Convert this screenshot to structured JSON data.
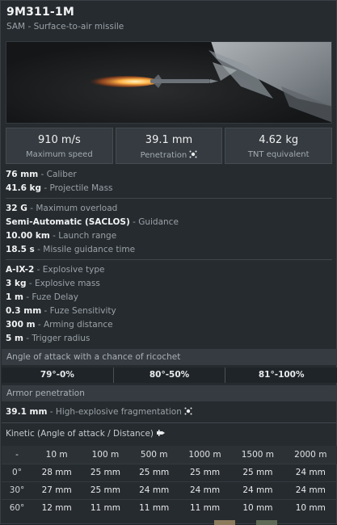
{
  "header": {
    "title": "9M311-1M",
    "subtitle": "SAM - Surface-to-air missile"
  },
  "stats": [
    {
      "value": "910 m/s",
      "label": "Maximum speed"
    },
    {
      "value": "39.1 mm",
      "label": "Penetration"
    },
    {
      "value": "4.62 kg",
      "label": "TNT equivalent"
    }
  ],
  "group1": [
    {
      "value": "76 mm",
      "label": "- Caliber"
    },
    {
      "value": "41.6 kg",
      "label": "- Projectile Mass"
    }
  ],
  "group2": [
    {
      "value": "32 G",
      "label": "- Maximum overload"
    },
    {
      "value": "Semi-Automatic (SACLOS)",
      "label": "- Guidance"
    },
    {
      "value": "10.00 km",
      "label": "- Launch range"
    },
    {
      "value": "18.5 s",
      "label": "- Missile guidance time"
    }
  ],
  "group3": [
    {
      "value": "A-IX-2",
      "label": "- Explosive type"
    },
    {
      "value": "3 kg",
      "label": "- Explosive mass"
    },
    {
      "value": "1 m",
      "label": "- Fuze Delay"
    },
    {
      "value": "0.3 mm",
      "label": "- Fuze Sensitivity"
    },
    {
      "value": "300 m",
      "label": "- Arming distance"
    },
    {
      "value": "5 m",
      "label": "- Trigger radius"
    }
  ],
  "ricochet": {
    "header": "Angle of attack with a chance of ricochet",
    "values": [
      "79°-0%",
      "80°-50%",
      "81°-100%"
    ]
  },
  "armor": {
    "header": "Armor penetration",
    "he_value": "39.1 mm",
    "he_label": "- High-explosive fragmentation",
    "kinetic_label": "Kinetic (Angle of attack / Distance)"
  },
  "table": {
    "columns": [
      "-",
      "10 m",
      "100 m",
      "500 m",
      "1000 m",
      "1500 m",
      "2000 m"
    ],
    "rows": [
      [
        "0°",
        "28 mm",
        "25 mm",
        "25 mm",
        "25 mm",
        "25 mm",
        "24 mm"
      ],
      [
        "30°",
        "27 mm",
        "25 mm",
        "24 mm",
        "24 mm",
        "24 mm",
        "24 mm"
      ],
      [
        "60°",
        "12 mm",
        "11 mm",
        "11 mm",
        "11 mm",
        "10 mm",
        "10 mm"
      ]
    ]
  },
  "icons": {
    "penetration": "explosion-icon",
    "he": "explosion-icon",
    "kinetic": "shell-icon"
  },
  "colors": {
    "background": "#262b2f",
    "panel": "#353b40",
    "text": "#e6e8ea",
    "muted": "#9aa2a8"
  }
}
